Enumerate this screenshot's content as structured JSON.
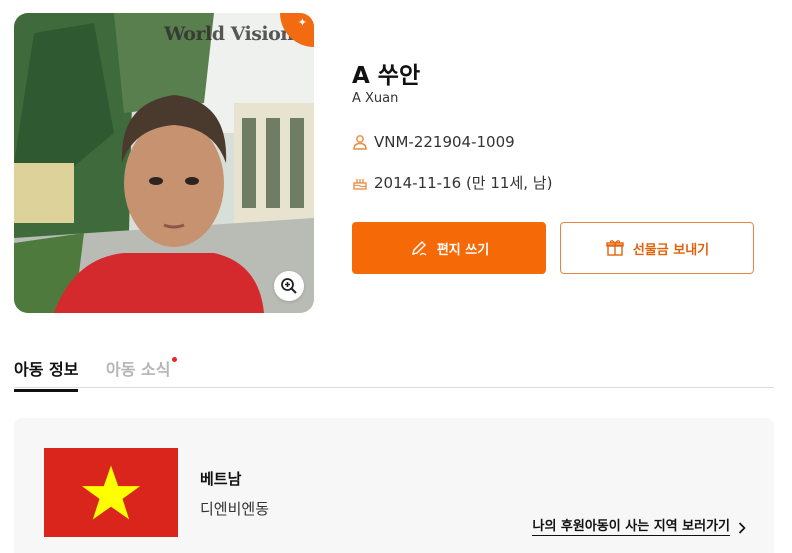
{
  "photo": {
    "logo_text": "World Vision"
  },
  "child": {
    "name": "A 쑤안",
    "name_en": "A Xuan",
    "id": "VNM-221904-1009",
    "birth": "2014-11-16 (만 11세, 남)"
  },
  "actions": {
    "letter_label": "편지 쓰기",
    "gift_label": "선물금 보내기"
  },
  "tabs": [
    {
      "label": "아동 정보",
      "active": true
    },
    {
      "label": "아동 소식",
      "active": false
    }
  ],
  "location": {
    "country": "베트남",
    "region": "디엔비엔동",
    "link_label": "나의 후원아동이 사는 지역 보러가기"
  },
  "colors": {
    "accent": "#f56a06",
    "flag_red": "#da251d",
    "flag_star": "#ffff00"
  }
}
